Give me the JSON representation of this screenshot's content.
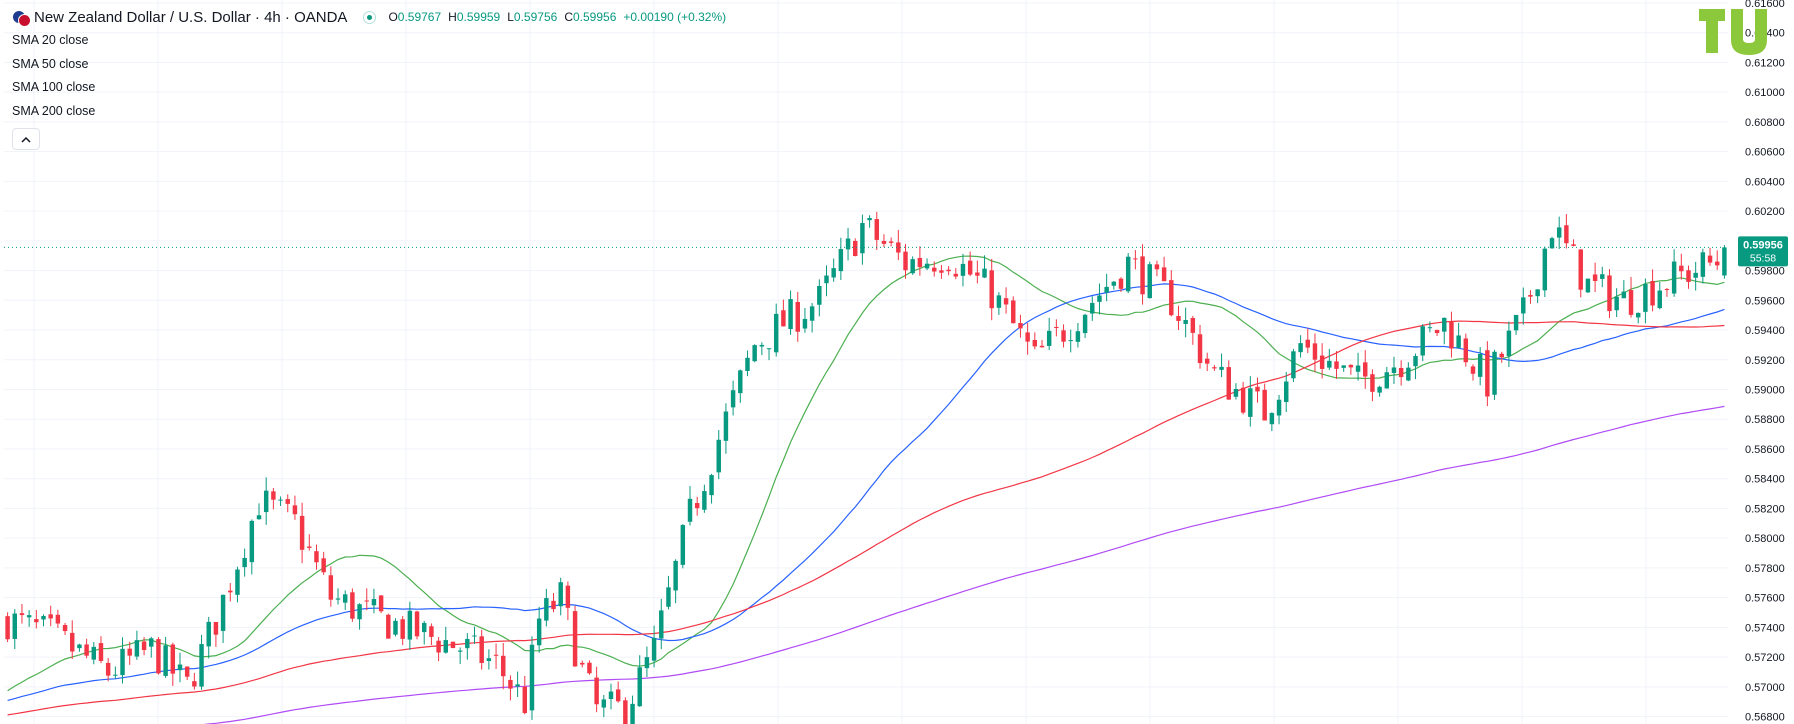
{
  "header": {
    "title": "New Zealand Dollar / U.S. Dollar · 4h · OANDA",
    "ohlc": {
      "o_label": "O",
      "o_value": "0.59767",
      "h_label": "H",
      "h_value": "0.59959",
      "l_label": "L",
      "l_value": "0.59756",
      "c_label": "C",
      "c_value": "0.59956",
      "change": "+0.00190 (+0.32%)"
    }
  },
  "indicators": [
    "SMA 20 close",
    "SMA 50 close",
    "SMA 100 close",
    "SMA 200 close"
  ],
  "price_label": {
    "value": "0.59956",
    "countdown": "55:58",
    "color": "#089981"
  },
  "colors": {
    "up": "#089981",
    "down": "#f23645",
    "sma20": "#4caf50",
    "sma50": "#2962ff",
    "sma100": "#f23645",
    "sma200": "#b14bf5",
    "logo": "#8bc83b"
  },
  "chart_data": {
    "type": "line",
    "subtype": "candlestick",
    "ylim": [
      0.5675,
      0.6162
    ],
    "y_ticks": [
      "0.56800",
      "0.57000",
      "0.57200",
      "0.57400",
      "0.57600",
      "0.57800",
      "0.58000",
      "0.58200",
      "0.58400",
      "0.58600",
      "0.58800",
      "0.59000",
      "0.59200",
      "0.59400",
      "0.59600",
      "0.59800",
      "0.60000",
      "0.60200",
      "0.60400",
      "0.60600",
      "0.60800",
      "0.61000",
      "0.61200",
      "0.61400",
      "0.61600"
    ],
    "grid": true,
    "last_price": 0.59956,
    "candle_count": 240,
    "close_path": [
      [
        0,
        0.5745
      ],
      [
        6,
        0.5735
      ],
      [
        14,
        0.571
      ],
      [
        20,
        0.5725
      ],
      [
        25,
        0.57
      ],
      [
        29,
        0.5745
      ],
      [
        35,
        0.5825
      ],
      [
        40,
        0.581
      ],
      [
        45,
        0.576
      ],
      [
        52,
        0.5745
      ],
      [
        58,
        0.5735
      ],
      [
        64,
        0.5725
      ],
      [
        68,
        0.5715
      ],
      [
        72,
        0.569
      ],
      [
        74,
        0.5745
      ],
      [
        77,
        0.576
      ],
      [
        80,
        0.571
      ],
      [
        82,
        0.5685
      ],
      [
        86,
        0.5685
      ],
      [
        90,
        0.5725
      ],
      [
        95,
        0.5815
      ],
      [
        100,
        0.588
      ],
      [
        104,
        0.593
      ],
      [
        108,
        0.5945
      ],
      [
        113,
        0.596
      ],
      [
        119,
        0.601
      ],
      [
        125,
        0.5985
      ],
      [
        131,
        0.599
      ],
      [
        137,
        0.5965
      ],
      [
        143,
        0.592
      ],
      [
        150,
        0.5955
      ],
      [
        156,
        0.5985
      ],
      [
        162,
        0.596
      ],
      [
        168,
        0.591
      ],
      [
        175,
        0.5885
      ],
      [
        180,
        0.593
      ],
      [
        188,
        0.5905
      ],
      [
        194,
        0.592
      ],
      [
        200,
        0.5945
      ],
      [
        206,
        0.5905
      ],
      [
        211,
        0.595
      ],
      [
        215,
        0.601
      ],
      [
        220,
        0.597
      ],
      [
        225,
        0.596
      ],
      [
        232,
        0.5975
      ],
      [
        240,
        0.599
      ]
    ],
    "series": [
      {
        "name": "SMA 20 close",
        "period": 20
      },
      {
        "name": "SMA 50 close",
        "period": 50
      },
      {
        "name": "SMA 100 close",
        "period": 100
      },
      {
        "name": "SMA 200 close",
        "period": 200
      }
    ]
  }
}
